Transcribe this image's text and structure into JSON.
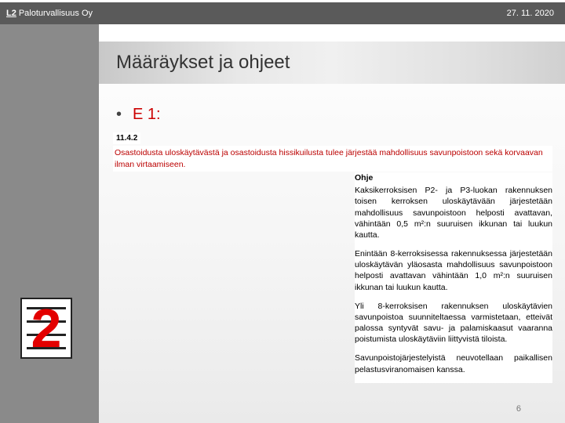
{
  "header": {
    "brand_short": "L2",
    "company": "Paloturvallisuus Oy",
    "date": "27. 11. 2020"
  },
  "title": "Määräykset ja ohjeet",
  "bullet": {
    "label": "E 1:"
  },
  "regulation": {
    "section": "11.4.2",
    "text": "Osastoidusta uloskäytävästä ja osastoidusta hissikuilusta tulee järjestää mahdollisuus savunpoistoon sekä korvaavan ilman virtaamiseen."
  },
  "ohje": {
    "heading": "Ohje",
    "p1": "Kaksikerroksisen P2- ja P3-luokan rakennuksen toisen kerroksen uloskäytävään järjestetään mahdollisuus savunpoistoon helposti avattavan, vähintään 0,5 m²:n suuruisen ikkunan tai luukun kautta.",
    "p2": "Enintään 8-kerroksisessa rakennuksessa järjestetään uloskäytävän yläosasta mahdollisuus savunpoistoon helposti avattavan vähintään 1,0 m²:n suuruisen ikkunan tai luukun kautta.",
    "p3": "Yli 8-kerroksisen rakennuksen uloskäytävien savunpoistoa suunniteltaessa varmistetaan, etteivät palossa syntyvät savu- ja palamiskaasut vaaranna poistumista uloskäytäviin liittyvistä tiloista.",
    "p4": "Savunpoistojärjestelyistä neuvotellaan paikallisen pelastusviranomaisen kanssa."
  },
  "logo_glyph": "2",
  "page_number": "6"
}
